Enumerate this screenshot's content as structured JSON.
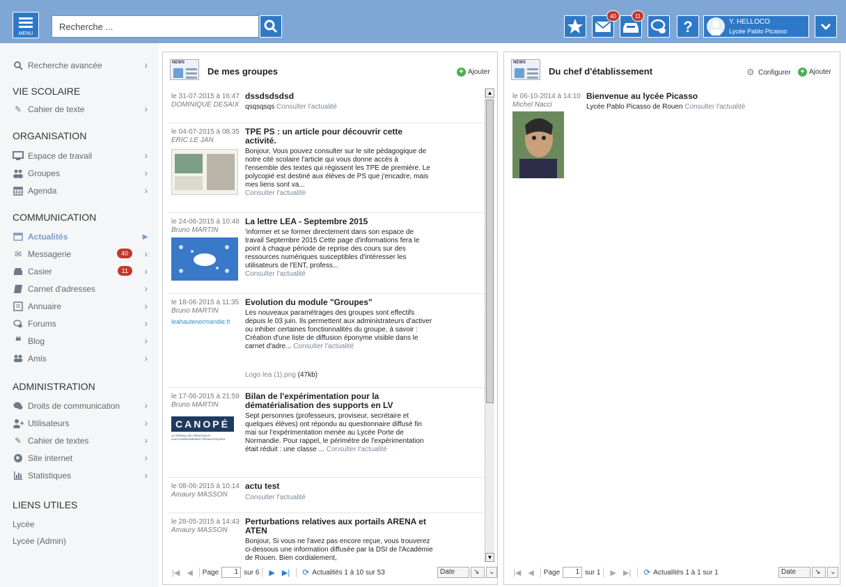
{
  "topbar": {
    "menu_label": "MENU",
    "search_placeholder": "Recherche ...",
    "messages_count": "40",
    "locker_count": "11",
    "user_name": "Y. HELLOCO",
    "user_school": "Lycée Pablo Picasso"
  },
  "sidebar": {
    "advanced_search": "Recherche avancée",
    "sections": [
      {
        "title": "VIE SCOLAIRE",
        "items": [
          "Cahier de texte"
        ]
      },
      {
        "title": "ORGANISATION",
        "items": [
          "Espace de travail",
          "Groupes",
          "Agenda"
        ]
      },
      {
        "title": "COMMUNICATION",
        "items": [
          "Actualités",
          "Messagerie",
          "Casier",
          "Carnet d'adresses",
          "Annuaire",
          "Forums",
          "Blog",
          "Amis"
        ]
      },
      {
        "title": "ADMINISTRATION",
        "items": [
          "Droits de communication",
          "Utilisateurs",
          "Cahier de textes",
          "Site internet",
          "Statistiques"
        ]
      },
      {
        "title": "LIENS UTILES",
        "links": [
          "Lycée",
          "Lycée (Admin)"
        ]
      }
    ],
    "messagerie_count": "40",
    "casier_count": "11"
  },
  "groups_panel": {
    "title": "De mes groupes",
    "add_label": "Ajouter",
    "consult": "Consulter l'actualité",
    "entries": [
      {
        "date": "le 31-07-2015 à 16:47",
        "author": "DOMINIQUE DESAIX",
        "title": "dssdsdsdsd",
        "body": "qsqsqsqs"
      },
      {
        "date": "le 04-07-2015 à 08:35",
        "author": "ERIC LE JAN",
        "title": "TPE PS : un article pour découvrir cette activité.",
        "body": "Bonjour, Vous pouvez consulter sur le site pédagogique de notre cité scolaire l'article qui vous donne accès à l'ensemble des textes qui régissent les TPE de première. Le polycopié est destiné aux élèves de PS que j'encadre, mais mes liens sont va..."
      },
      {
        "date": "le 24-06-2015 à 10:48",
        "author": "Bruno MARTIN",
        "title": "La lettre LEA - Septembre 2015",
        "body": "'informer et se former directement dans son espace de travail Septembre 2015 Cette page d'informations fera le point à chaque période de reprise des cours sur des ressources numériques susceptibles d'intéresser les utilisateurs de l'ENT, profess..."
      },
      {
        "date": "le 18-06-2015 à 11:35",
        "author": "Bruno MARTIN",
        "title": "Evolution du module \"Groupes\"",
        "body": "Les nouveaux paramétrages des groupes sont effectifs depuis le 03 juin. Ils permettent aux administrateurs d'activer ou inhiber certaines fonctionnalités du groupe, à savoir : Création d'une liste de diffusion éponyme visible dans le carnet d'adre...",
        "attachment": "Logo lea (1).png",
        "attachment_size": "(47kb)",
        "thumb_text": "leahautenormandie.fr"
      },
      {
        "date": "le 17-06-2015 à 21:59",
        "author": "Bruno MARTIN",
        "title": "Bilan de l'expérimentation pour la dématérialisation des supports en LV",
        "body": "Sept personnes (professeurs, proviseur, secrétaire et quelques élèves) ont répondu au questionnaire diffusé fin mai sur l'expérimentation menée au Lycée Porte de Normandie. Pour rappel, le périmètre de l'expérimentation était réduit : une classe ...",
        "thumb_text": "CANOPÉ",
        "thumb_sub": "LE RÉSEAU DE CRÉATION ET D'ACCOMPAGNEMENT PÉDAGOGIQUES"
      },
      {
        "date": "le 08-06-2015 à 10:14",
        "author": "Amaury MASSON",
        "title": "actu test",
        "body": ""
      },
      {
        "date": "le 28-05-2015 à 14:43",
        "author": "Amaury MASSON",
        "title": "Perturbations relatives aux portails ARENA et ATEN",
        "body": "Bonjour, Si vous ne l'avez pas encore reçue, vous trouverez ci-dessous une information diffusée par la DSI de l'Académie de Rouen. Bien cordialement,"
      }
    ],
    "pager": {
      "page_label": "Page",
      "page_value": "1",
      "of": "sur 6",
      "summary": "Actualités 1 à 10 sur 53",
      "sort": "Date"
    }
  },
  "chief_panel": {
    "title": "Du chef d'établissement",
    "configure_label": "Configurer",
    "add_label": "Ajouter",
    "entry": {
      "date": "le 06-10-2014 à 14:10",
      "author": "Michel Nacci",
      "title": "Bienvenue au lycée Picasso",
      "body": "Lycée Pablo Picasso de Rouen",
      "consult": "Consulter l'actualité"
    },
    "pager": {
      "page_label": "Page",
      "page_value": "1",
      "of": "sur 1",
      "summary": "Actualités 1 à 1 sur 1",
      "sort": "Date"
    }
  },
  "icons": {
    "news_tag": "NEWS"
  },
  "colors": {
    "topbar": "#7fa7d6",
    "button": "#2e79c7",
    "badge": "#c0392b",
    "active_link": "#7d9cc6"
  }
}
